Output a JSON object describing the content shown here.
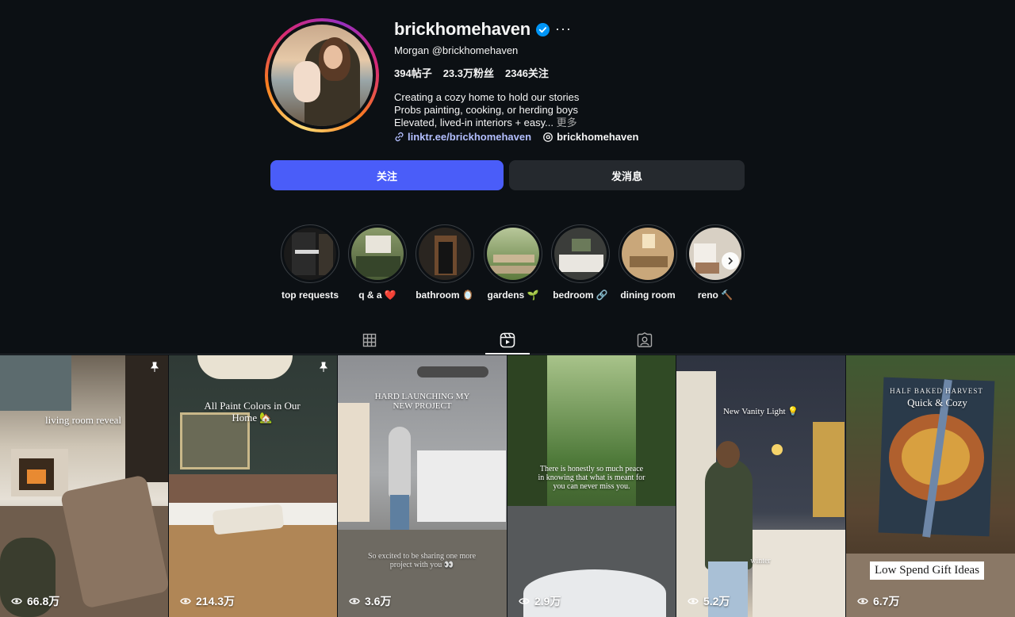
{
  "profile": {
    "username": "brickhomehaven",
    "more_icon": "···",
    "full_name": "Morgan @brickhomehaven",
    "stats": {
      "posts": "394帖子",
      "followers": "23.3万粉丝",
      "following": "2346关注"
    },
    "bio": {
      "line1": "Creating a cozy home to hold our stories",
      "line2": "Probs painting, cooking, or herding boys",
      "line3": "Elevated, lived-in interiors + easy...",
      "more": "更多"
    },
    "link": "linktr.ee/brickhomehaven",
    "threads": "brickhomehaven"
  },
  "actions": {
    "follow": "关注",
    "message": "发消息"
  },
  "highlights": [
    {
      "label": "top requests"
    },
    {
      "label": "q & a ❤️"
    },
    {
      "label": "bathroom 🪞"
    },
    {
      "label": "gardens 🌱"
    },
    {
      "label": "bedroom 🔗"
    },
    {
      "label": "dining room"
    },
    {
      "label": "reno 🔨"
    }
  ],
  "tabs": {
    "active": "reels",
    "items": [
      "posts-grid-icon",
      "reels-icon",
      "tagged-icon"
    ]
  },
  "reels": [
    {
      "caption": "living room reveal",
      "views": "66.8万",
      "pinned": true
    },
    {
      "caption": "All Paint Colors in Our Home 🏡",
      "views": "214.3万",
      "pinned": true
    },
    {
      "caption": "HARD LAUNCHING MY NEW PROJECT",
      "caption2": "So excited to be sharing one more project with you 👀",
      "views": "3.6万",
      "pinned": false
    },
    {
      "caption": "There is honestly so much peace in knowing that what is meant for you can never miss you.",
      "views": "2.9万",
      "pinned": false
    },
    {
      "caption": "New Vanity Light 💡",
      "caption2": "winter",
      "views": "5.2万",
      "pinned": false
    },
    {
      "caption": "Low Spend Gift Ideas",
      "book_title": "Quick & Cozy",
      "book_top": "HALF BAKED HARVEST",
      "views": "6.7万",
      "pinned": false
    }
  ],
  "colors": {
    "accent": "#4a5df9",
    "background": "#0c1014",
    "secondary_button": "#25292e",
    "link": "#b3bfff"
  }
}
